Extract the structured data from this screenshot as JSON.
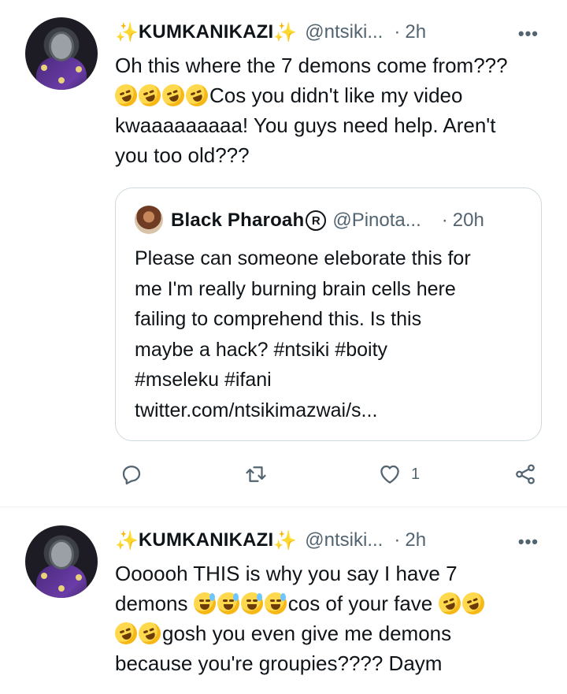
{
  "tweets": [
    {
      "display_name": "KUMKANIKAZI",
      "handle": "@ntsiki...",
      "separator": "·",
      "time": "2h",
      "more": "•••",
      "text_lines": [
        "Oh this where the 7 demons come from???",
        "Cos you didn't like my video",
        "kwaaaaaaaaa! You guys need help. Aren't",
        "you too old???"
      ],
      "quoted": {
        "display_name": "Black Pharoah",
        "badge": "R",
        "handle": "@Pinota...",
        "separator": "·",
        "time": "20h",
        "text_lines": [
          "Please can someone eleborate this for",
          "me I'm really burning brain cells here",
          "failing to comprehend this. Is this",
          "maybe a hack? #ntsiki #boity",
          "#mseleku #ifani",
          "twitter.com/ntsikimazwai/s..."
        ]
      },
      "actions": {
        "reply_icon": "reply-icon",
        "retweet_icon": "retweet-icon",
        "like_icon": "heart-icon",
        "like_count": "1",
        "share_icon": "share-icon"
      }
    },
    {
      "display_name": "KUMKANIKAZI",
      "handle": "@ntsiki...",
      "separator": "·",
      "time": "2h",
      "more": "•••",
      "text_lines": [
        "Oooooh THIS is why you say I have 7",
        "demons",
        "cos of your fave",
        "gosh you even give me demons",
        "because you're groupies???? Daym"
      ]
    }
  ],
  "colors": {
    "text": "#0f1419",
    "secondary": "#536471",
    "border": "#cfd9de",
    "sparkle": "#f5b400"
  }
}
